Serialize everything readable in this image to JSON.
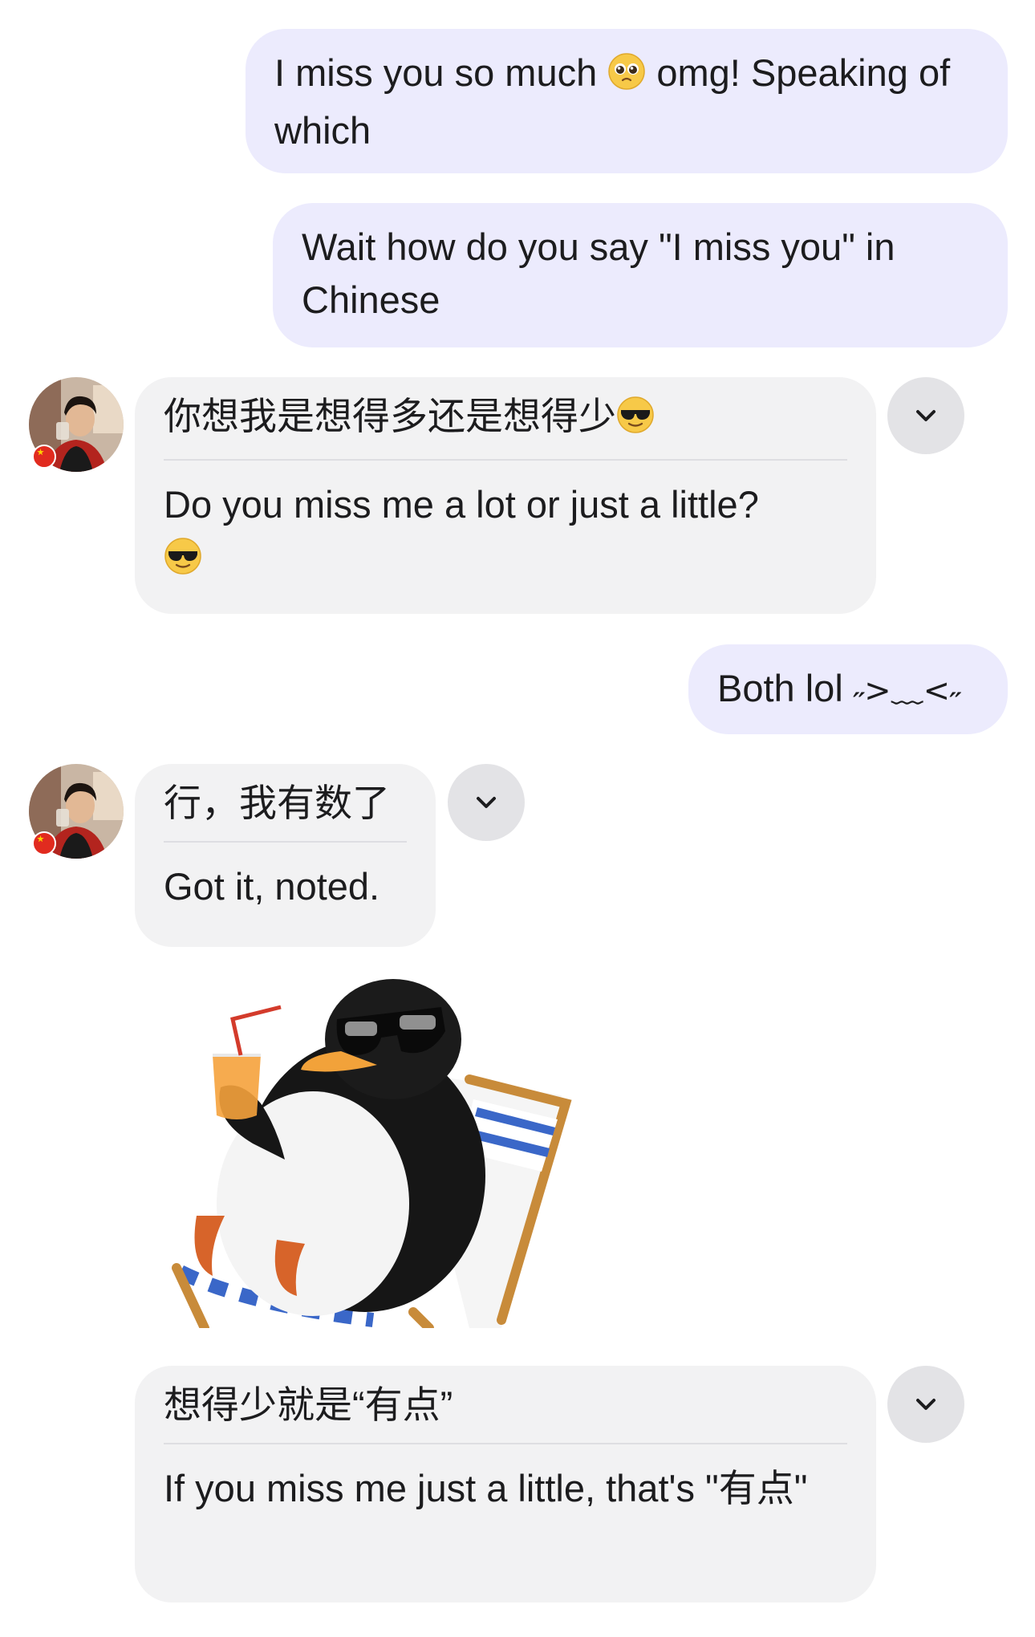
{
  "messages": [
    {
      "text_a": "I miss you so much ",
      "emoji": "pleading-face",
      "text_b": " omg! Speaking of which"
    },
    {
      "text": "Wait how do you say \"I miss you\" in Chinese"
    },
    {
      "original": "你想我是想得多还是想得少",
      "emoji": "sunglasses-face",
      "translation": "Do you miss me a lot or just a little?"
    },
    {
      "text": "Both lol ",
      "kaomoji": "˶>﹏<˶"
    },
    {
      "original": "行，我有数了",
      "translation": "Got it, noted."
    },
    {
      "sticker": "penguin-sunglasses-deckchair-sticker"
    },
    {
      "original": "想得少就是“有点”",
      "translation": "If you miss me just a little, that's \"有点\""
    }
  ],
  "icons": {
    "expand": "chevron-down-icon",
    "avatar": "contact-avatar",
    "flag": "china-flag-icon"
  },
  "colors": {
    "outgoing_bubble": "#ecebfd",
    "incoming_bubble": "#f2f2f3",
    "chevron_button": "#e3e3e6",
    "flag_red": "#e12b1f"
  }
}
